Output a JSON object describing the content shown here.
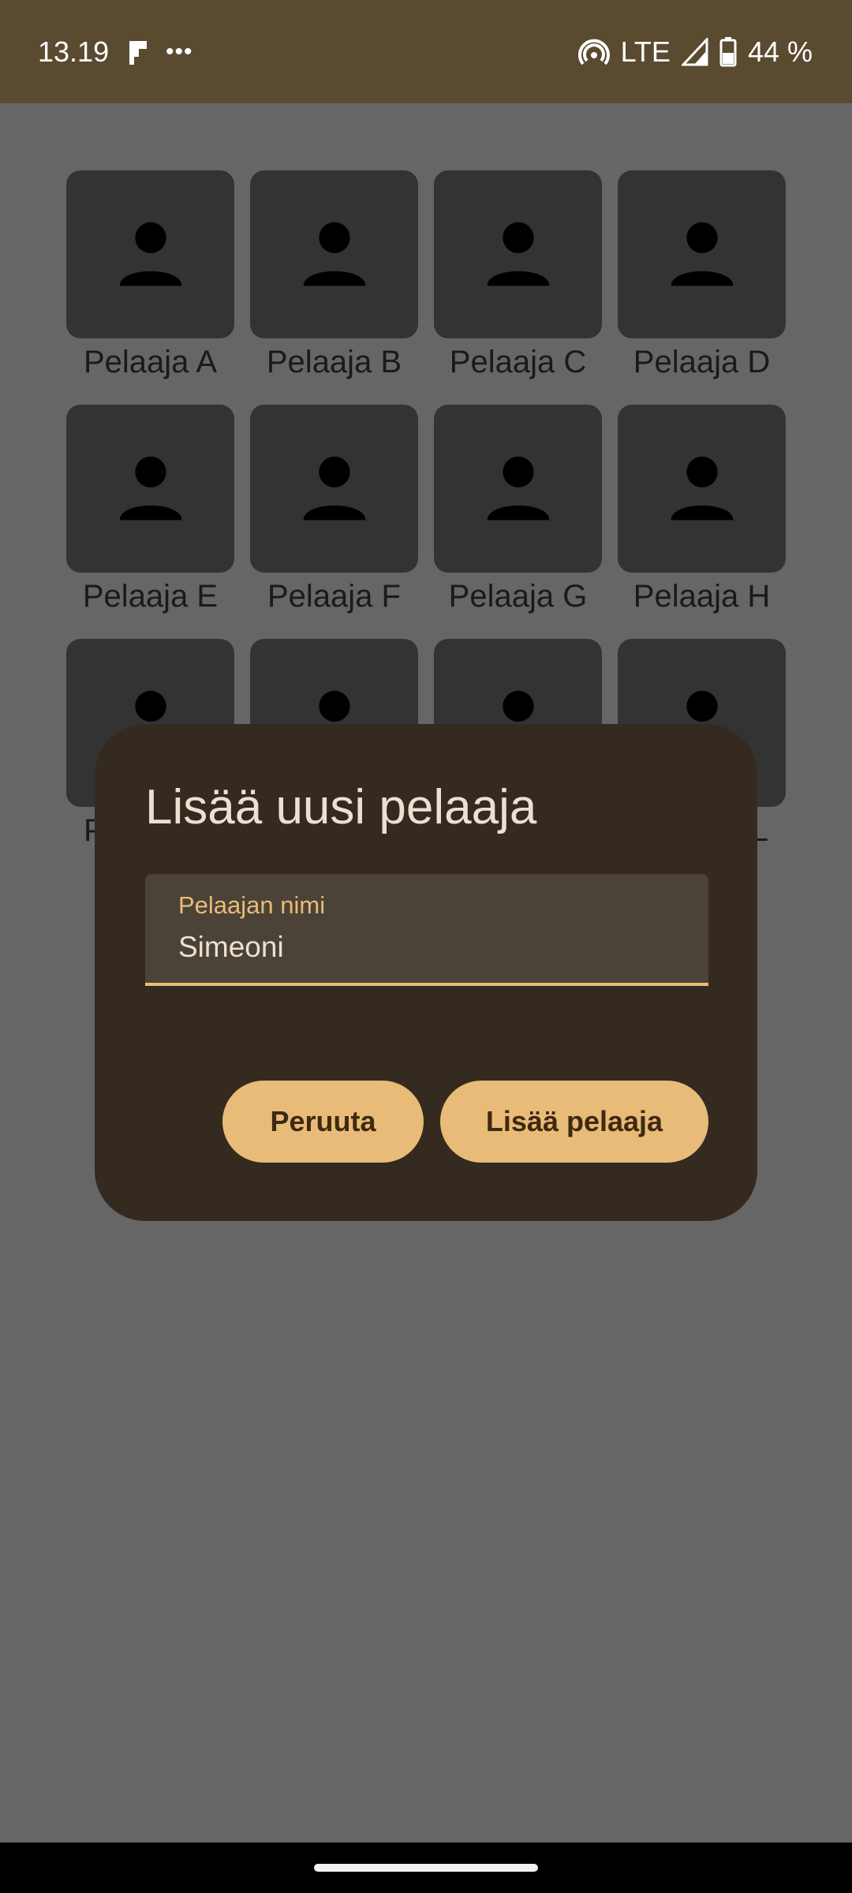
{
  "status_bar": {
    "time": "13.19",
    "app_icon": "flipboard-icon",
    "more_dots": "•••",
    "network": "LTE",
    "battery_percent": "44 %",
    "icons": [
      "hotspot-icon",
      "signal-icon",
      "battery-icon"
    ]
  },
  "players": [
    {
      "name": "Pelaaja A"
    },
    {
      "name": "Pelaaja B"
    },
    {
      "name": "Pelaaja C"
    },
    {
      "name": "Pelaaja D"
    },
    {
      "name": "Pelaaja E"
    },
    {
      "name": "Pelaaja F"
    },
    {
      "name": "Pelaaja G"
    },
    {
      "name": "Pelaaja H"
    },
    {
      "name": "P"
    },
    {
      "name": ""
    },
    {
      "name": ""
    },
    {
      "name": "L"
    }
  ],
  "dialog": {
    "title": "Lisää uusi pelaaja",
    "field_label": "Pelaajan nimi",
    "field_value": "Simeoni",
    "cancel_label": "Peruuta",
    "add_label": "Lisää pelaaja"
  },
  "colors": {
    "status_bar": "#5a4a30",
    "dialog_bg": "#342a20",
    "accent": "#e9bb78",
    "scrim_bg": "#666666"
  }
}
